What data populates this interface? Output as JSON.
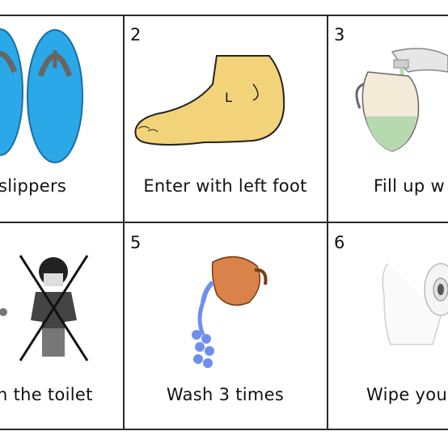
{
  "cells": [
    {
      "number": "",
      "caption": "slippers",
      "icon": "flip-flops-icon"
    },
    {
      "number": "2",
      "caption": "Enter with left foot",
      "icon": "left-foot-icon",
      "foot_letter": "L"
    },
    {
      "number": "3",
      "caption": "Fill up w",
      "icon": "jug-under-tap-icon"
    },
    {
      "number": "",
      "caption": "n the toilet",
      "icon": "no-standing-boy-icon"
    },
    {
      "number": "5",
      "caption": "Wash 3 times",
      "icon": "pouring-jug-icon"
    },
    {
      "number": "6",
      "caption": "Wipe you",
      "icon": "toilet-paper-icon"
    }
  ],
  "colors": {
    "grid": "#2a2a2a",
    "slipper_blue": "#2aa8e8",
    "foot_skin": "#f3d37a",
    "jug_water": "#b7d9b0",
    "pot_orange": "#d9824a",
    "water_blue": "#6f8ff0"
  }
}
